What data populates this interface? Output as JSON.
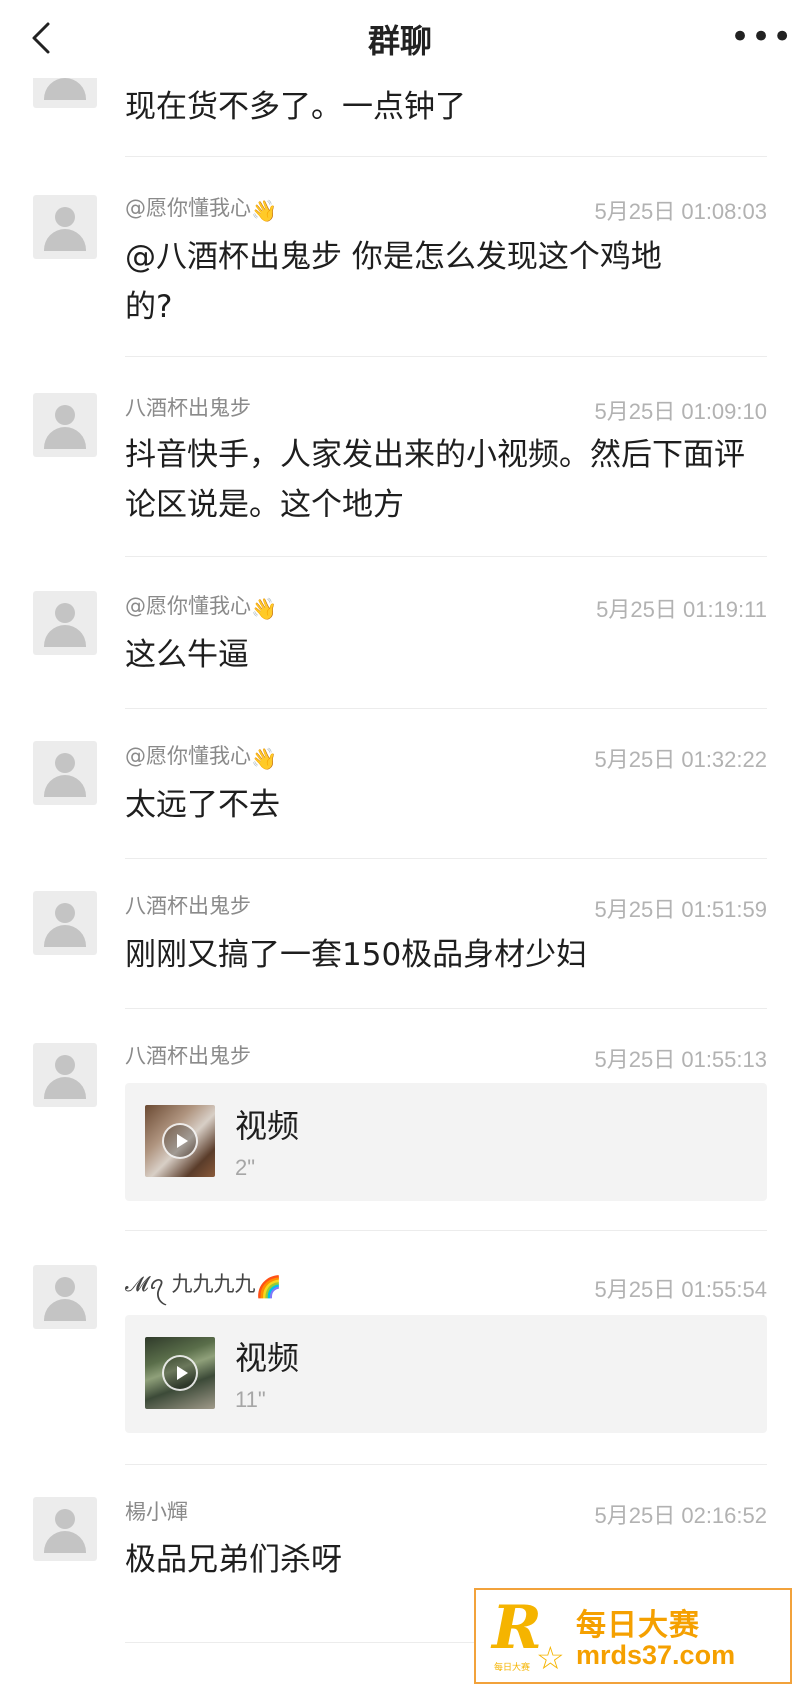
{
  "header": {
    "title": "群聊",
    "back_icon": "chevron-left-icon",
    "more_icon": "more-dots-icon",
    "more_glyph": "•••"
  },
  "messages": [
    {
      "type": "text",
      "sender": "",
      "time": "",
      "text": "现在货不多了。一点钟了"
    },
    {
      "type": "text",
      "sender": "@愿你懂我心",
      "sender_emoji": "👋",
      "time": "5月25日 01:08:03",
      "text": "@八酒杯出鬼步 你是怎么发现这个鸡地的?"
    },
    {
      "type": "text",
      "sender": "八酒杯出鬼步",
      "time": "5月25日 01:09:10",
      "text": "抖音快手，人家发出来的小视频。然后下面评论区说是。这个地方"
    },
    {
      "type": "text",
      "sender": "@愿你懂我心",
      "sender_emoji": "👋",
      "time": "5月25日 01:19:11",
      "text": "这么牛逼"
    },
    {
      "type": "text",
      "sender": "@愿你懂我心",
      "sender_emoji": "👋",
      "time": "5月25日 01:32:22",
      "text": "太远了不去"
    },
    {
      "type": "text",
      "sender": "八酒杯出鬼步",
      "time": "5月25日 01:51:59",
      "text": "刚刚又搞了一套150极品身材少妇"
    },
    {
      "type": "video",
      "sender": "八酒杯出鬼步",
      "time": "5月25日 01:55:13",
      "video_label": "视频",
      "duration": "2\""
    },
    {
      "type": "video",
      "sender": "𝓜ꪖ 九九九九",
      "sender_emoji": "🌈",
      "time": "5月25日 01:55:54",
      "video_label": "视频",
      "duration": "11\""
    },
    {
      "type": "text",
      "sender": "楊小輝",
      "time": "5月25日 02:16:52",
      "text": "极品兄弟们杀呀"
    }
  ],
  "watermark": {
    "logo_letter": "R",
    "logo_small": "每日大赛",
    "name": "每日大赛",
    "url": "mrds37.com"
  }
}
